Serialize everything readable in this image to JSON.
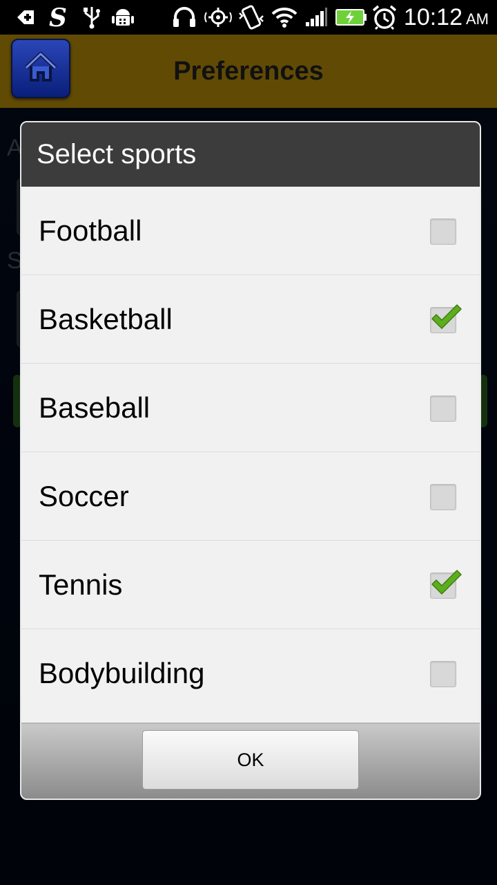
{
  "status_bar": {
    "time": "10:12",
    "ampm": "AM",
    "icons": [
      "add-notification-icon",
      "s-app-icon",
      "usb-icon",
      "android-debug-icon",
      "headphones-icon",
      "gps-icon",
      "vibrate-icon",
      "wifi-icon",
      "signal-icon",
      "battery-charging-icon",
      "alarm-icon"
    ],
    "battery_color": "#6fd13a"
  },
  "header": {
    "title": "Preferences",
    "home_icon": "home-icon",
    "background": "#614b04"
  },
  "background_peek": {
    "letter_1": "A",
    "letter_2": "S"
  },
  "dialog": {
    "title": "Select sports",
    "options": [
      {
        "label": "Football",
        "checked": false
      },
      {
        "label": "Basketball",
        "checked": true
      },
      {
        "label": "Baseball",
        "checked": false
      },
      {
        "label": "Soccer",
        "checked": false
      },
      {
        "label": "Tennis",
        "checked": true
      },
      {
        "label": "Bodybuilding",
        "checked": false
      }
    ],
    "ok_label": "OK",
    "check_color": "#5cae1c"
  }
}
